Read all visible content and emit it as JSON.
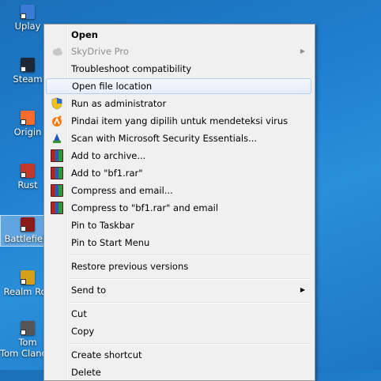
{
  "desktop": {
    "icons": [
      {
        "label": "Uplay",
        "color": "#3a7bd5"
      },
      {
        "label": "Steam",
        "color": "#1b2838"
      },
      {
        "label": "Origin",
        "color": "#f56c2d"
      },
      {
        "label": "Rust",
        "color": "#c0392b"
      },
      {
        "label": "Battlefield",
        "color": "#8b1a1a"
      },
      {
        "label": "Realm Roy",
        "color": "#d4a017"
      },
      {
        "label": "Tom Clancy's R",
        "color": "#555555"
      }
    ]
  },
  "context_menu": {
    "items": {
      "open": "Open",
      "skydrive": "SkyDrive Pro",
      "troubleshoot": "Troubleshoot compatibility",
      "open_location": "Open file location",
      "run_admin": "Run as administrator",
      "avast_scan": "Pindai item yang dipilih untuk mendeteksi virus",
      "mse_scan": "Scan with Microsoft Security Essentials...",
      "add_archive": "Add to archive...",
      "add_rar": "Add to \"bf1.rar\"",
      "compress_email": "Compress and email...",
      "compress_rar_email": "Compress to \"bf1.rar\" and email",
      "pin_taskbar": "Pin to Taskbar",
      "pin_start": "Pin to Start Menu",
      "restore": "Restore previous versions",
      "send_to": "Send to",
      "cut": "Cut",
      "copy": "Copy",
      "create_shortcut": "Create shortcut",
      "delete": "Delete"
    },
    "submenu_arrow": "▶",
    "colors": {
      "hover_border": "#aecff7",
      "menu_bg": "#f0f0f0",
      "disabled_text": "#8e8e8e"
    }
  }
}
